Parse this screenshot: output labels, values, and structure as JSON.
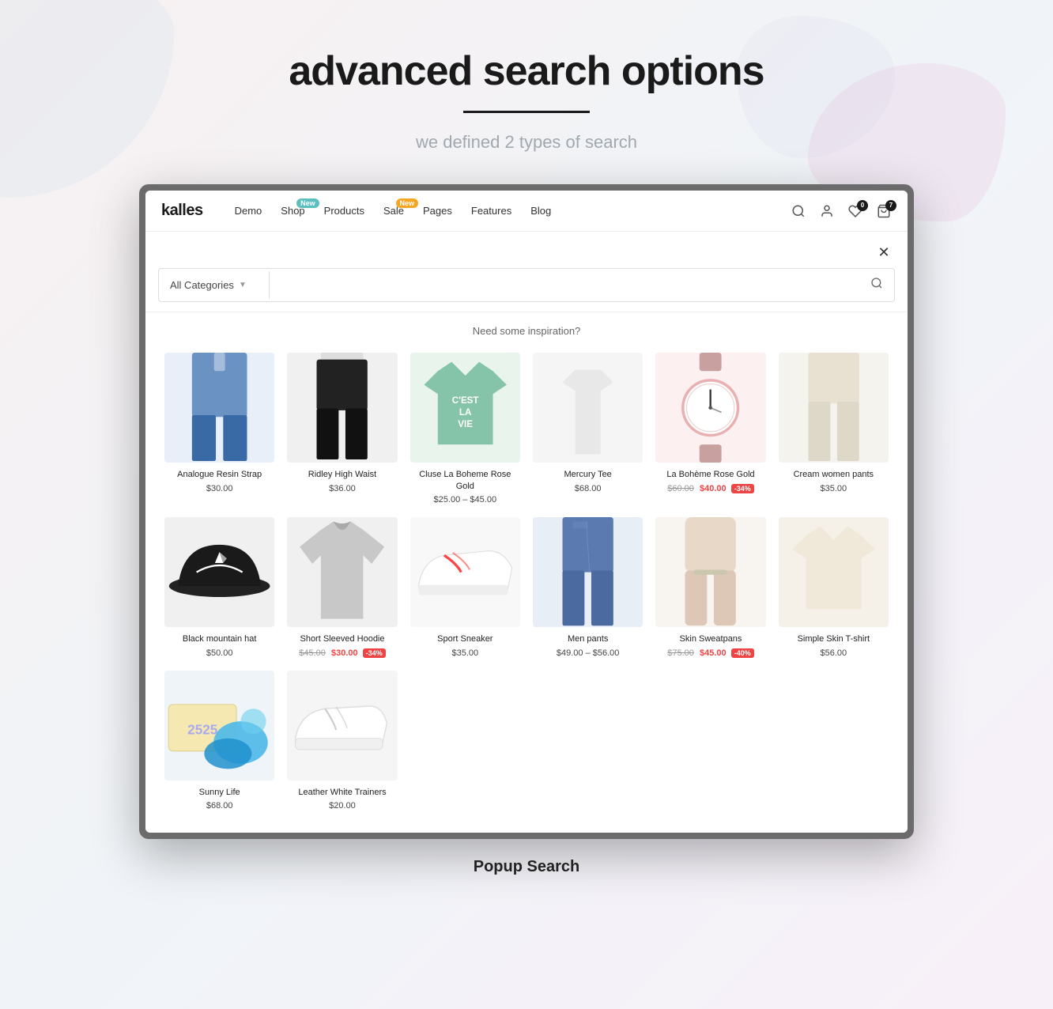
{
  "page": {
    "title": "advanced search  options",
    "underline": true,
    "subtitle": "we defined 2 types of search",
    "bottom_label": "Popup Search"
  },
  "navbar": {
    "logo": "kalles",
    "links": [
      {
        "label": "Demo",
        "badge": null
      },
      {
        "label": "Shop",
        "badge": {
          "text": "New",
          "color": "teal"
        }
      },
      {
        "label": "Products",
        "badge": null
      },
      {
        "label": "Sale",
        "badge": {
          "text": "New",
          "color": "orange"
        }
      },
      {
        "label": "Pages",
        "badge": null
      },
      {
        "label": "Features",
        "badge": null
      },
      {
        "label": "Blog",
        "badge": null
      }
    ],
    "icons": [
      {
        "name": "search",
        "badge": null
      },
      {
        "name": "user",
        "badge": null
      },
      {
        "name": "wishlist",
        "badge": {
          "count": "0"
        }
      },
      {
        "name": "cart",
        "badge": {
          "count": "7"
        }
      }
    ]
  },
  "search": {
    "category_placeholder": "All Categories",
    "input_placeholder": "",
    "inspiration_label": "Need some inspiration?",
    "close_label": "×"
  },
  "products": [
    {
      "name": "Analogue Resin Strap",
      "price": "$30.00",
      "original_price": null,
      "sale_price": null,
      "discount": null,
      "color": "#e8eff8",
      "type": "pants"
    },
    {
      "name": "Ridley High Waist",
      "price": "$36.00",
      "original_price": null,
      "sale_price": null,
      "discount": null,
      "color": "#f0f0f0",
      "type": "black-pants"
    },
    {
      "name": "Cluse La Boheme Rose Gold",
      "price": "$25.00 – $45.00",
      "original_price": null,
      "sale_price": null,
      "discount": null,
      "color": "#e8f4ec",
      "type": "tshirt-green"
    },
    {
      "name": "Mercury Tee",
      "price": "$68.00",
      "original_price": null,
      "sale_price": null,
      "discount": null,
      "color": "#f5f5f5",
      "type": "white-top"
    },
    {
      "name": "La Bohème Rose Gold",
      "price": null,
      "original_price": "$60.00",
      "sale_price": "$40.00",
      "discount": "-34%",
      "color": "#fdf0f0",
      "type": "watch"
    },
    {
      "name": "Cream women pants",
      "price": "$35.00",
      "original_price": null,
      "sale_price": null,
      "discount": null,
      "color": "#f5f3ee",
      "type": "cream-pants"
    },
    {
      "name": "Black mountain hat",
      "price": "$50.00",
      "original_price": null,
      "sale_price": null,
      "discount": null,
      "color": "#f0f0f0",
      "type": "hat"
    },
    {
      "name": "Short Sleeved Hoodie",
      "price": null,
      "original_price": "$45.00",
      "sale_price": "$30.00",
      "discount": "-34%",
      "color": "#f0f0f0",
      "type": "hoodie"
    },
    {
      "name": "Sport Sneaker",
      "price": "$35.00",
      "original_price": null,
      "sale_price": null,
      "discount": null,
      "color": "#f8f8f8",
      "type": "sneaker"
    },
    {
      "name": "Men pants",
      "price": "$49.00 – $56.00",
      "original_price": null,
      "sale_price": null,
      "discount": null,
      "color": "#e8eef5",
      "type": "jeans"
    },
    {
      "name": "Skin Sweatpans",
      "price": null,
      "original_price": "$75.00",
      "sale_price": "$45.00",
      "discount": "-40%",
      "color": "#f8f4f0",
      "type": "sweatpants"
    },
    {
      "name": "Simple Skin T-shirt",
      "price": "$56.00",
      "original_price": null,
      "sale_price": null,
      "discount": null,
      "color": "#f5f0e8",
      "type": "skin-tshirt"
    },
    {
      "name": "Sunny Life",
      "price": "$68.00",
      "original_price": null,
      "sale_price": null,
      "discount": null,
      "color": "#eef4f8",
      "type": "accessories"
    },
    {
      "name": "Leather White Trainers",
      "price": "$20.00",
      "original_price": null,
      "sale_price": null,
      "discount": null,
      "color": "#f5f5f5",
      "type": "white-trainers"
    }
  ]
}
